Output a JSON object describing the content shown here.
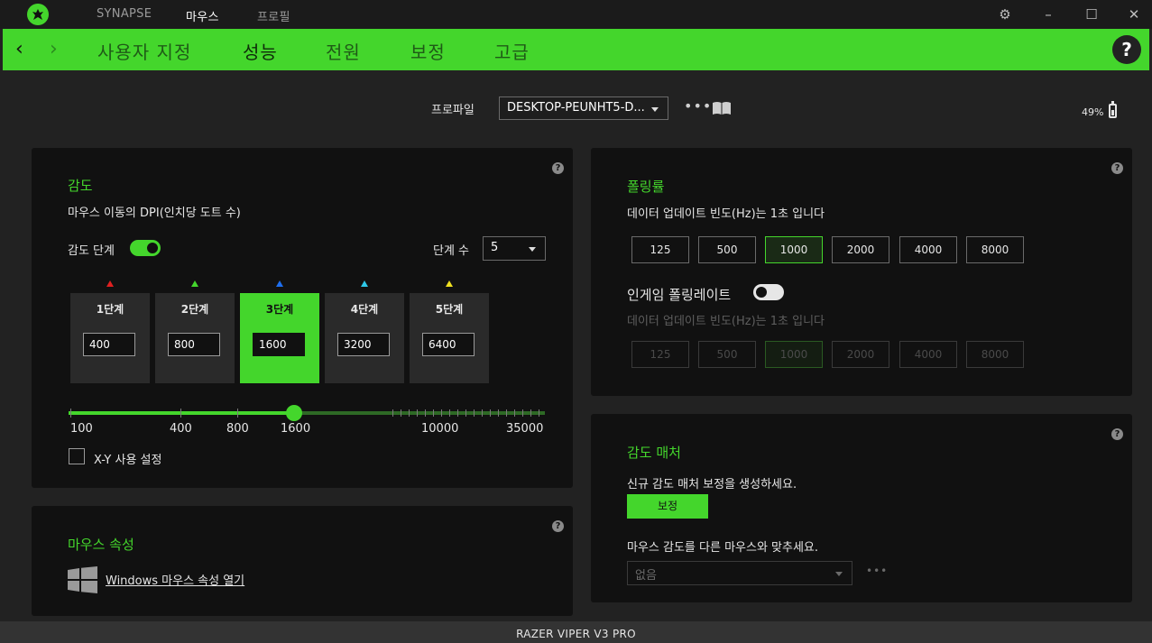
{
  "titlebar": {
    "tabs": [
      "SYNAPSE",
      "마우스",
      "프로필"
    ],
    "active_tab": "마우스"
  },
  "navbar": {
    "tabs": [
      "사용자 지정",
      "성능",
      "전원",
      "보정",
      "고급"
    ],
    "active_tab": "성능",
    "help": "?"
  },
  "profile": {
    "label": "프로파일",
    "value": "DESKTOP-PEUNHT5-D..."
  },
  "battery": {
    "text": "49%",
    "level_percent": 49
  },
  "sensitivity": {
    "title": "감도",
    "description": "마우스 이동의 DPI(인치당 도트 수)",
    "stages_label": "감도 단계",
    "stages_enabled": true,
    "stage_count_label": "단계 수",
    "stage_count": "5",
    "stages": [
      {
        "label": "1단계",
        "value": "400",
        "color": "#e02020"
      },
      {
        "label": "2단계",
        "value": "800",
        "color": "#44d62c"
      },
      {
        "label": "3단계",
        "value": "1600",
        "color": "#1e6ff0"
      },
      {
        "label": "4단계",
        "value": "3200",
        "color": "#2ec8e8"
      },
      {
        "label": "5단계",
        "value": "6400",
        "color": "#f0e020"
      }
    ],
    "active_stage": 3,
    "slider_labels": [
      "100",
      "400",
      "800",
      "1600",
      "10000",
      "35000"
    ],
    "slider_value": 1600,
    "xy_label": "X-Y 사용 설정",
    "xy_enabled": false
  },
  "mouse_props": {
    "title": "마우스 속성",
    "link": "Windows 마우스 속성 열기"
  },
  "polling": {
    "title": "폴링률",
    "description": "데이터 업데이트 빈도(Hz)는 1초 입니다",
    "rates": [
      "125",
      "500",
      "1000",
      "2000",
      "4000",
      "8000"
    ],
    "active_rate": "1000",
    "ingame_label": "인게임 폴링레이트",
    "ingame_enabled": false,
    "ingame_description": "데이터 업데이트 빈도(Hz)는 1초 입니다"
  },
  "matcher": {
    "title": "감도 매처",
    "description": "신규 감도 매처 보정을 생성하세요.",
    "button": "보정",
    "match_label": "마우스 감도를 다른 마우스와 맞추세요.",
    "select_value": "없음"
  },
  "footer": {
    "device": "RAZER VIPER V3 PRO"
  },
  "colors": {
    "accent": "#44d62c",
    "background": "#222222",
    "panel": "#111111"
  },
  "icons": [
    "razer-logo-icon",
    "gear-icon",
    "minimize-icon",
    "maximize-icon",
    "close-icon",
    "back-arrow-icon",
    "forward-arrow-icon",
    "help-icon",
    "more-dots-icon",
    "book-icon",
    "battery-icon",
    "windows-icon"
  ]
}
